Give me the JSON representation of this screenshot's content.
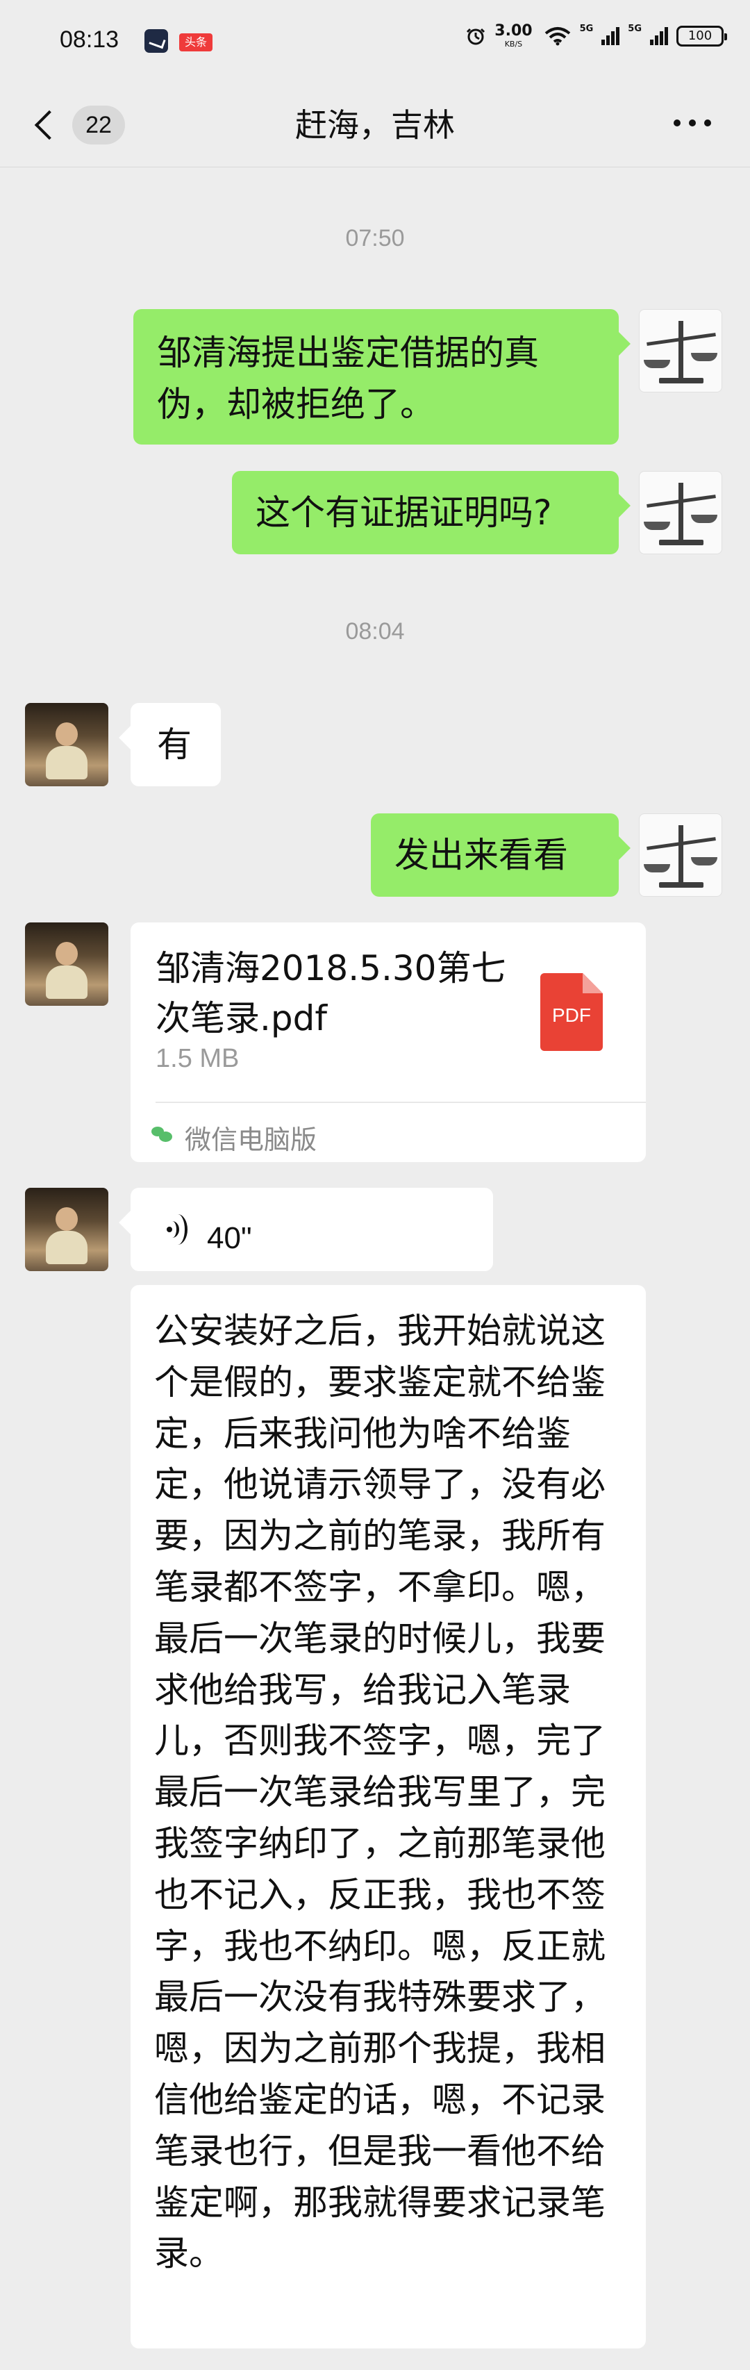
{
  "status_bar": {
    "time": "08:13",
    "badge": "头条",
    "speed_value": "3.00",
    "speed_unit": "KB/S",
    "network_1": "5G",
    "network_2": "5G",
    "battery": "100"
  },
  "header": {
    "unread_count": "22",
    "title": "赶海，吉林"
  },
  "timestamps": [
    "07:50",
    "08:04"
  ],
  "messages": {
    "sent_1": "邹清海提出鉴定借据的真伪，却被拒绝了。",
    "sent_2": "这个有证据证明吗?",
    "received_1": "有",
    "sent_3": "发出来看看",
    "file_message": {
      "name": "邹清海2018.5.30第七次笔录.pdf",
      "size": "1.5 MB",
      "type_label": "PDF",
      "source": "微信电脑版"
    },
    "voice_message": {
      "duration": "40\""
    },
    "transcript": "公安装好之后，我开始就说这个是假的，要求鉴定就不给鉴定，后来我问他为啥不给鉴定，他说请示领导了，没有必要，因为之前的笔录，我所有笔录都不签字，不拿印。嗯，最后一次笔录的时候儿，我要求他给我写，给我记入笔录儿，否则我不签字，嗯，完了最后一次笔录给我写里了，完我签字纳印了，之前那笔录他也不记入，反正我，我也不签字，我也不纳印。嗯，反正就最后一次没有我特殊要求了，嗯，因为之前那个我提，我相信他给鉴定的话，嗯，不记录笔录也行，但是我一看他不给鉴定啊，那我就得要求记录笔录。"
  },
  "colors": {
    "background": "#ededed",
    "sent_bubble": "#95ec69",
    "received_bubble": "#ffffff",
    "pdf_icon": "#e94235",
    "timestamp_text": "#9a9a9a"
  },
  "icons": {
    "back": "chevron-left-icon",
    "more": "more-horizontal-icon",
    "pdf": "pdf-file-icon",
    "voice": "voice-wave-icon",
    "source": "wechat-pc-icon"
  }
}
